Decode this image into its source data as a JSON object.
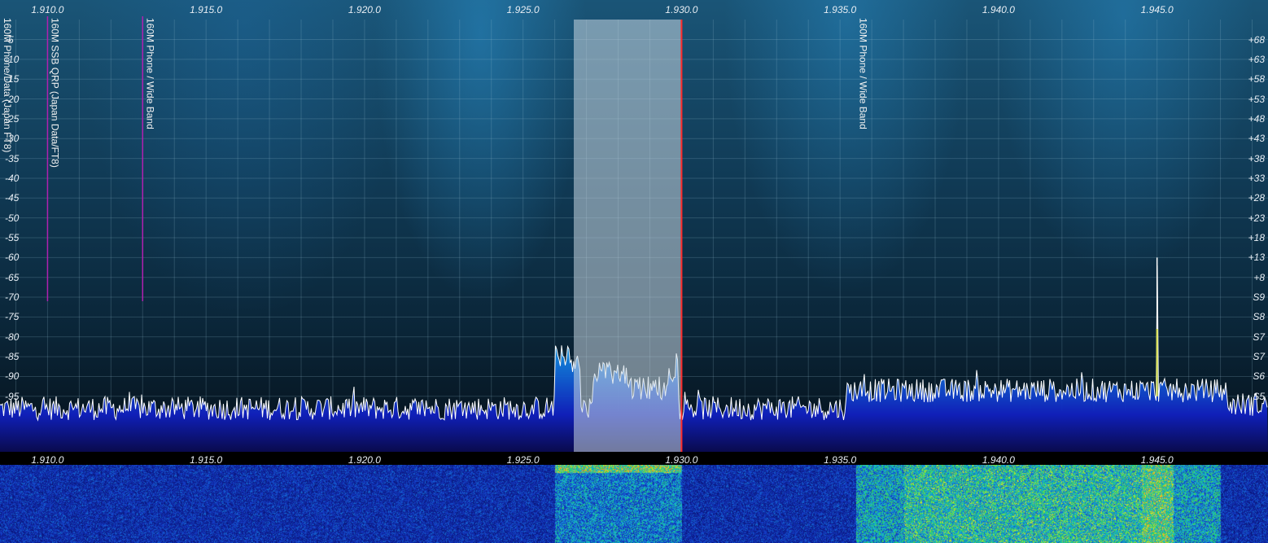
{
  "frequency_scale": {
    "ticks": [
      "1.910.0",
      "1.915.0",
      "1.920.0",
      "1.925.0",
      "1.930.0",
      "1.935.0",
      "1.940.0",
      "1.945.0"
    ],
    "tick_mhz": [
      1.91,
      1.915,
      1.92,
      1.925,
      1.93,
      1.935,
      1.94,
      1.945
    ],
    "range_mhz": [
      1.9085,
      1.9485
    ]
  },
  "db_scale": {
    "labels": [
      "-5",
      "-10",
      "-15",
      "-20",
      "-25",
      "-30",
      "-35",
      "-40",
      "-45",
      "-50",
      "-55",
      "-60",
      "-65",
      "-70",
      "-75",
      "-80",
      "-85",
      "-90",
      "-95"
    ],
    "values": [
      -5,
      -10,
      -15,
      -20,
      -25,
      -30,
      -35,
      -40,
      -45,
      -50,
      -55,
      -60,
      -65,
      -70,
      -75,
      -80,
      -85,
      -90,
      -95
    ]
  },
  "s_meter_scale": {
    "labels": [
      "+68",
      "+63",
      "+58",
      "+53",
      "+48",
      "+43",
      "+38",
      "+33",
      "+28",
      "+23",
      "+18",
      "+13",
      "+8",
      "S9",
      "S8",
      "S7",
      "S7",
      "S6",
      "S5"
    ],
    "values": [
      -5,
      -10,
      -15,
      -20,
      -25,
      -30,
      -35,
      -40,
      -45,
      -50,
      -55,
      -60,
      -65,
      -70,
      -75,
      -80,
      -85,
      -90,
      -95
    ]
  },
  "band_markers": [
    {
      "label": "160M Phone/Data (Japan FT8)",
      "mhz": 1.9085,
      "with_line": false
    },
    {
      "label": "160M SSB QRP (Japan Data/FT8)",
      "mhz": 1.91,
      "with_line": true
    },
    {
      "label": "160M Phone / Wide Band",
      "mhz": 1.913,
      "with_line": true
    },
    {
      "label": "160M Phone / Wide Band",
      "mhz": 1.9355,
      "with_line": false
    }
  ],
  "receive_filter": {
    "low_mhz": 1.9266,
    "high_mhz": 1.93
  },
  "vfo_frequency_mhz": 1.93,
  "colors": {
    "vfo_line": "#ff2a2a",
    "band_marker_line": "#b020b0",
    "spectrum_trace": "#ffffff",
    "filter_overlay": "rgba(200,215,225,0.55)",
    "grid": "rgba(150,190,210,0.22)"
  },
  "icons": [
    "spectrum-trace",
    "waterfall-display"
  ]
}
